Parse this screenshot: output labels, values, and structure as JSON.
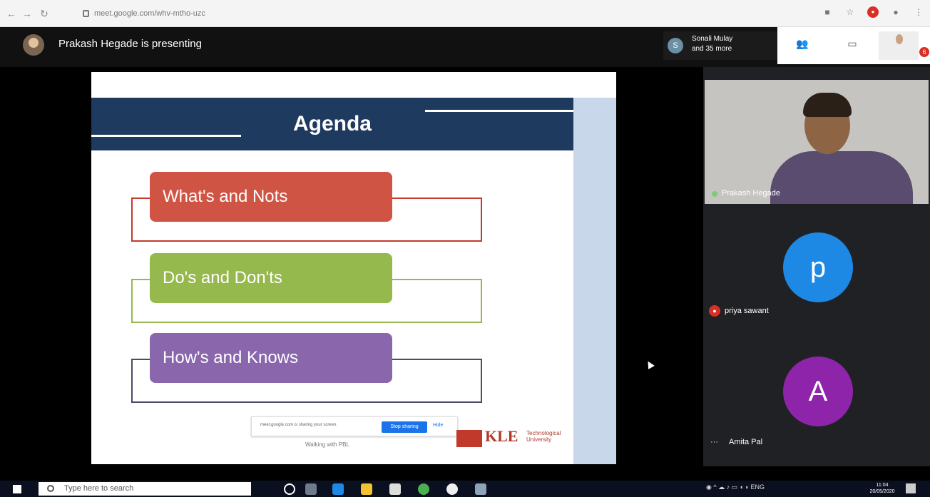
{
  "browser": {
    "url": "meet.google.com/whv-mtho-uzc"
  },
  "meet": {
    "presenting_text": "Prakash Hegade is presenting",
    "participants_summary_line1": "Sonali Mulay",
    "participants_summary_line2": "and 35 more",
    "people_avatar_letter": "S",
    "self_badge": "6"
  },
  "slide": {
    "title": "Agenda",
    "items": [
      {
        "label": "What's and Nots",
        "color": "#d05444"
      },
      {
        "label": "Do's and Don'ts",
        "color": "#95b94c"
      },
      {
        "label": "How's and Knows",
        "color": "#8a66ad"
      }
    ],
    "share_bar": {
      "text": "meet.google.com is sharing your screen.",
      "stop_label": "Stop sharing",
      "hide_label": "Hide"
    },
    "footer": "Walking with PBL",
    "logo_text": "KLE",
    "logo_sub": "Technological University"
  },
  "tiles": [
    {
      "name": "Prakash Hegade",
      "type": "video"
    },
    {
      "name": "priya sawant",
      "avatar_letter": "p",
      "avatar_color": "#1e88e5"
    },
    {
      "name": "Amita Pal",
      "avatar_letter": "A",
      "avatar_color": "#8e24aa"
    }
  ],
  "taskbar": {
    "search_placeholder": "Type here to search",
    "time": "11:04",
    "date": "20/05/2020",
    "lang": "ENG"
  }
}
